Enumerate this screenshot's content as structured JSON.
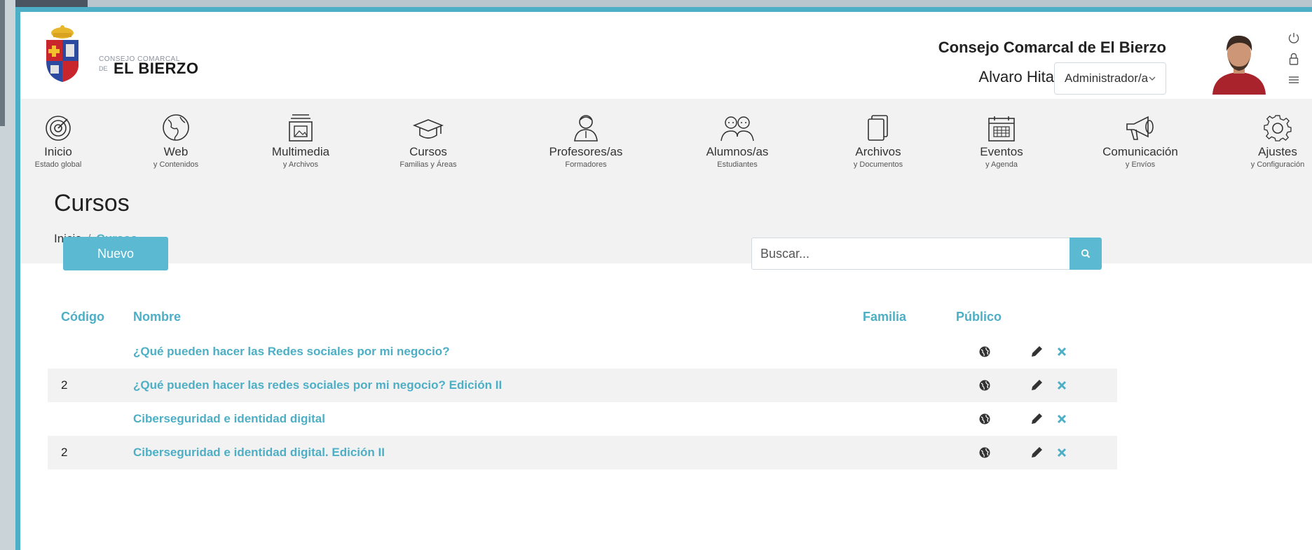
{
  "header": {
    "logo_line1": "CONSEJO COMARCAL",
    "logo_line2": "DE",
    "logo_line3": "EL BIERZO",
    "org_name": "Consejo Comarcal de El Bierzo",
    "user_name": "Alvaro Hita",
    "role_selected": "Administrador/a",
    "icons": [
      "power-icon",
      "lock-icon",
      "menu-icon"
    ]
  },
  "nav": {
    "items": [
      {
        "label": "Inicio",
        "sub": "Estado global",
        "icon": "dashboard-icon"
      },
      {
        "label": "Web",
        "sub": "y Contenidos",
        "icon": "globe-icon"
      },
      {
        "label": "Multimedia",
        "sub": "y Archivos",
        "icon": "media-icon"
      },
      {
        "label": "Cursos",
        "sub": "Familias y Áreas",
        "icon": "graduation-cap-icon"
      },
      {
        "label": "Profesores/as",
        "sub": "Formadores",
        "icon": "teacher-icon"
      },
      {
        "label": "Alumnos/as",
        "sub": "Estudiantes",
        "icon": "students-icon"
      },
      {
        "label": "Archivos",
        "sub": "y Documentos",
        "icon": "files-icon"
      },
      {
        "label": "Eventos",
        "sub": "y Agenda",
        "icon": "calendar-icon"
      },
      {
        "label": "Comunicación",
        "sub": "y Envíos",
        "icon": "megaphone-icon"
      },
      {
        "label": "Ajustes",
        "sub": "y Configuración",
        "icon": "gear-icon"
      }
    ]
  },
  "page": {
    "title": "Cursos",
    "breadcrumb_home": "Inicio",
    "breadcrumb_sep": "/",
    "breadcrumb_current": "Cursos"
  },
  "toolbar": {
    "new_label": "Nuevo",
    "search_placeholder": "Buscar..."
  },
  "table": {
    "headers": {
      "code": "Código",
      "name": "Nombre",
      "family": "Familia",
      "public": "Público"
    },
    "rows": [
      {
        "code": "",
        "name": "¿Qué pueden hacer las Redes sociales por mi negocio?",
        "public": true
      },
      {
        "code": "2",
        "name": "¿Qué pueden hacer las redes sociales por mi negocio? Edición II",
        "public": true
      },
      {
        "code": "",
        "name": "Ciberseguridad e identidad digital",
        "public": true
      },
      {
        "code": "2",
        "name": "Ciberseguridad e identidad digital. Edición II",
        "public": true
      }
    ]
  },
  "colors": {
    "accent": "#4dafc6",
    "button": "#5bbad2",
    "nav_bg": "#f2f2f2"
  }
}
